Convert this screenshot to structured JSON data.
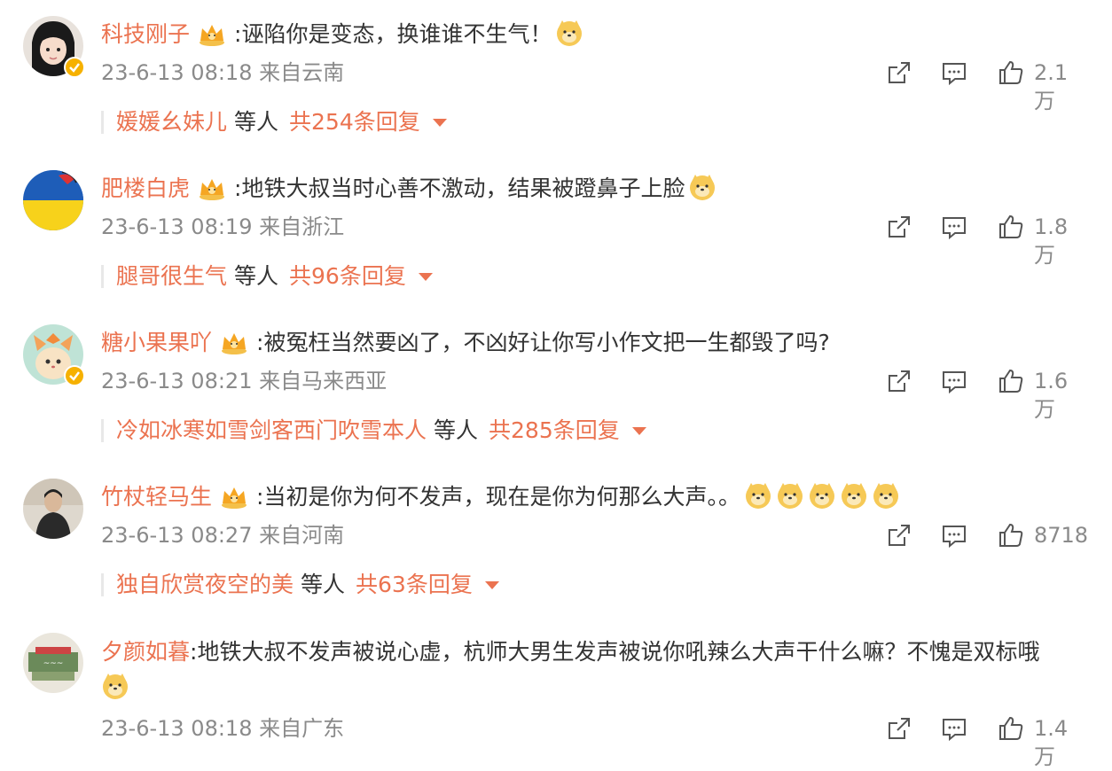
{
  "comments": [
    {
      "username": "科技刚子",
      "text": ":诬陷你是变态，换谁谁不生气！",
      "emojis": 1,
      "verified": true,
      "crown": true,
      "date": "23-6-13 08:18",
      "location": "来自云南",
      "likes": "2.1万",
      "reply_user": "媛媛幺妹儿",
      "reply_mid": "等人",
      "reply_count": "共254条回复"
    },
    {
      "username": "肥楼白虎",
      "text": ":地铁大叔当时心善不激动，结果被蹬鼻子上脸",
      "emojis": 1,
      "verified": false,
      "crown": true,
      "date": "23-6-13 08:19",
      "location": "来自浙江",
      "likes": "1.8万",
      "reply_user": "腿哥很生气",
      "reply_mid": "等人",
      "reply_count": "共96条回复"
    },
    {
      "username": "糖小果果吖",
      "text": ":被冤枉当然要凶了，不凶好让你写小作文把一生都毁了吗?",
      "emojis": 0,
      "verified": true,
      "crown": true,
      "date": "23-6-13 08:21",
      "location": "来自马来西亚",
      "likes": "1.6万",
      "reply_user": "冷如冰寒如雪剑客西门吹雪本人",
      "reply_mid": "等人",
      "reply_count": "共285条回复"
    },
    {
      "username": "竹杖轻马生",
      "text": ":当初是你为何不发声，现在是你为何那么大声。。",
      "emojis": 5,
      "verified": false,
      "crown": true,
      "date": "23-6-13 08:27",
      "location": "来自河南",
      "likes": "8718",
      "reply_user": "独自欣赏夜空的美",
      "reply_mid": "等人",
      "reply_count": "共63条回复"
    },
    {
      "username": "夕颜如暮",
      "text": ":地铁大叔不发声被说心虚，杭师大男生发声被说你吼辣么大声干什么嘛？不愧是双标哦",
      "emojis": 1,
      "verified": false,
      "crown": false,
      "date": "23-6-13 08:18",
      "location": "来自广东",
      "likes": "1.4万"
    }
  ],
  "colors": {
    "username": "#eb7350",
    "meta": "#8a8a8a",
    "text": "#333333"
  },
  "icons": [
    "share-icon",
    "comment-icon",
    "like-icon",
    "crown-icon",
    "doge-emoji",
    "verified-badge"
  ]
}
